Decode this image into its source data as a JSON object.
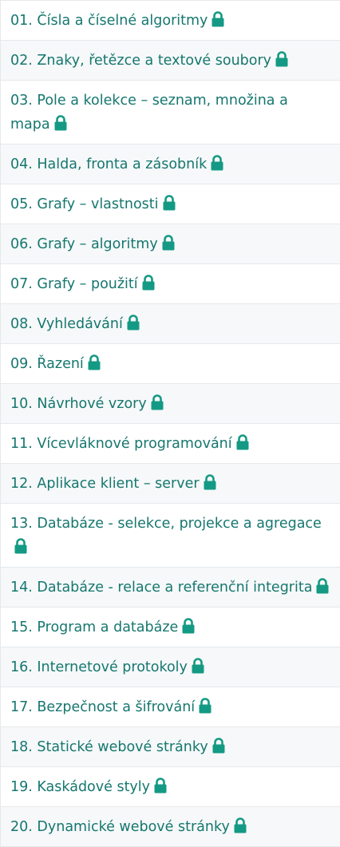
{
  "colors": {
    "link": "#16776f",
    "lock": "#149a84",
    "row_alt": "#f6f8f9",
    "border": "#e6e9ec"
  },
  "lessons": [
    {
      "label": "01. Čísla a číselné algoritmy",
      "icon": "lock-icon"
    },
    {
      "label": "02. Znaky, řetězce a textové soubory",
      "icon": "lock-icon"
    },
    {
      "label": "03. Pole a kolekce – seznam, množina a mapa",
      "icon": "lock-icon"
    },
    {
      "label": "04. Halda, fronta a zásobník",
      "icon": "lock-icon"
    },
    {
      "label": "05. Grafy – vlastnosti",
      "icon": "lock-icon"
    },
    {
      "label": "06. Grafy – algoritmy",
      "icon": "lock-icon"
    },
    {
      "label": "07. Grafy – použití",
      "icon": "lock-icon"
    },
    {
      "label": "08. Vyhledávání",
      "icon": "lock-icon"
    },
    {
      "label": "09. Řazení",
      "icon": "lock-icon"
    },
    {
      "label": "10. Návrhové vzory",
      "icon": "lock-icon"
    },
    {
      "label": "11. Vícevláknové programování",
      "icon": "lock-icon"
    },
    {
      "label": "12. Aplikace klient – server",
      "icon": "lock-icon"
    },
    {
      "label": "13. Databáze - selekce, projekce a agregace",
      "icon": "lock-icon"
    },
    {
      "label": "14. Databáze - relace a referenční integrita",
      "icon": "lock-icon"
    },
    {
      "label": "15. Program a databáze",
      "icon": "lock-icon"
    },
    {
      "label": "16. Internetové protokoly",
      "icon": "lock-icon"
    },
    {
      "label": "17. Bezpečnost a šifrování",
      "icon": "lock-icon"
    },
    {
      "label": "18. Statické webové stránky",
      "icon": "lock-icon"
    },
    {
      "label": "19. Kaskádové styly",
      "icon": "lock-icon"
    },
    {
      "label": "20. Dynamické webové stránky",
      "icon": "lock-icon"
    }
  ]
}
